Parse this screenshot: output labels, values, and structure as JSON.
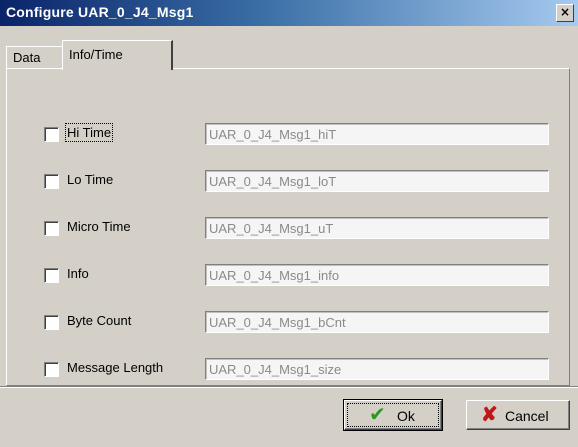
{
  "window": {
    "title": "Configure UAR_0_J4_Msg1",
    "close_glyph": "×"
  },
  "tabs": [
    {
      "label": "Data",
      "active": false
    },
    {
      "label": "Info/Time",
      "active": true
    }
  ],
  "rows": [
    {
      "label": "Hi Time",
      "checked": false,
      "value": "UAR_0_J4_Msg1_hiT",
      "focused": true
    },
    {
      "label": "Lo Time",
      "checked": false,
      "value": "UAR_0_J4_Msg1_loT"
    },
    {
      "label": "Micro Time",
      "checked": false,
      "value": "UAR_0_J4_Msg1_uT"
    },
    {
      "label": "Info",
      "checked": false,
      "value": "UAR_0_J4_Msg1_info"
    },
    {
      "label": "Byte Count",
      "checked": false,
      "value": "UAR_0_J4_Msg1_bCnt"
    },
    {
      "label": "Message Length",
      "checked": false,
      "value": "UAR_0_J4_Msg1_size"
    }
  ],
  "buttons": {
    "ok": {
      "label": "Ok",
      "icon": "checkmark-icon",
      "icon_glyph": "✔",
      "color": "#2a9a1a"
    },
    "cancel": {
      "label": "Cancel",
      "icon": "x-icon",
      "icon_glyph": "✘",
      "color": "#c01818"
    }
  }
}
